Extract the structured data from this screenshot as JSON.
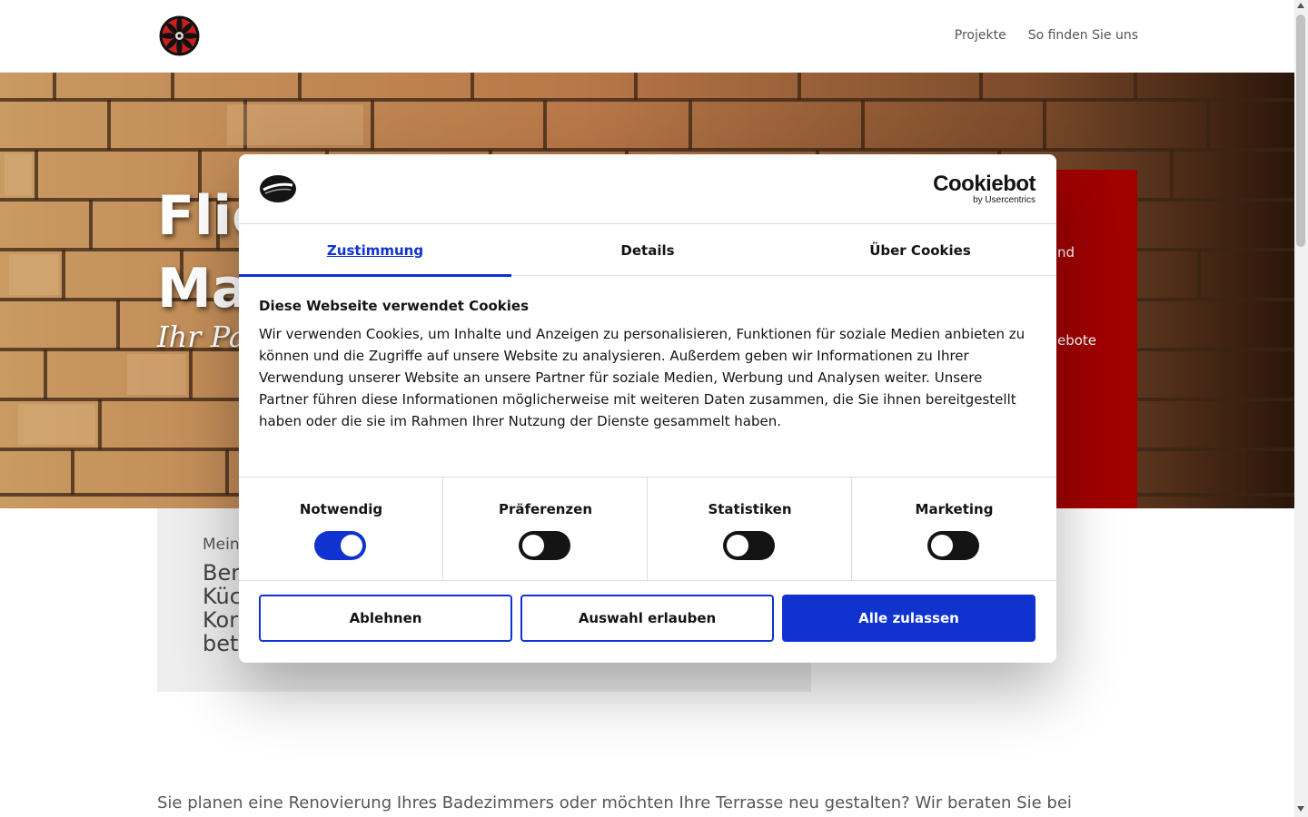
{
  "header": {
    "nav": [
      "Projekte",
      "So finden Sie uns"
    ]
  },
  "hero": {
    "title_visible": "Flie\nMa",
    "subtitle_visible": "Ihr Pa",
    "red_box_fragments": [
      "nd",
      "ebote"
    ]
  },
  "content": {
    "card_small_visible": "Mein",
    "card_big_visible": "Ber\nKüc\nKor\nbet",
    "intro_text": "Sie planen eine Renovierung Ihres Badezimmers oder möchten Ihre Terrasse neu gestalten? Wir beraten Sie bei"
  },
  "cookie_dialog": {
    "brand": "Cookiebot",
    "brand_sub": "by Usercentrics",
    "tabs": [
      "Zustimmung",
      "Details",
      "Über Cookies"
    ],
    "active_tab": "Zustimmung",
    "heading": "Diese Webseite verwendet Cookies",
    "text": "Wir verwenden Cookies, um Inhalte und Anzeigen zu personalisieren, Funktionen für soziale Medien anbieten zu können und die Zugriffe auf unsere Website zu analysieren. Außerdem geben wir Informationen zu Ihrer Verwendung unserer Website an unsere Partner für soziale Medien, Werbung und Analysen weiter. Unsere Partner führen diese Informationen möglicherweise mit weiteren Daten zusammen, die Sie ihnen bereitgestellt haben oder die sie im Rahmen Ihrer Nutzung der Dienste gesammelt haben.",
    "toggles": [
      {
        "label": "Notwendig",
        "on": true
      },
      {
        "label": "Präferenzen",
        "on": false
      },
      {
        "label": "Statistiken",
        "on": false
      },
      {
        "label": "Marketing",
        "on": false
      }
    ],
    "buttons": {
      "decline": "Ablehnen",
      "allow_selection": "Auswahl erlauben",
      "allow_all": "Alle zulassen"
    }
  },
  "colors": {
    "accent": "#1032cf",
    "hero_red": "#a00000"
  }
}
